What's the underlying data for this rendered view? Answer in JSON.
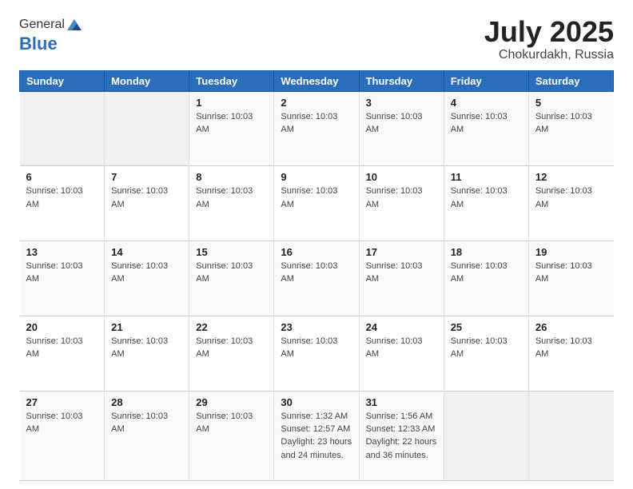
{
  "logo": {
    "general": "General",
    "blue": "Blue"
  },
  "header": {
    "month": "July 2025",
    "location": "Chokurdakh, Russia"
  },
  "columns": [
    "Sunday",
    "Monday",
    "Tuesday",
    "Wednesday",
    "Thursday",
    "Friday",
    "Saturday"
  ],
  "weeks": [
    [
      {
        "day": "",
        "info": ""
      },
      {
        "day": "",
        "info": ""
      },
      {
        "day": "1",
        "info": "Sunrise: 10:03 AM"
      },
      {
        "day": "2",
        "info": "Sunrise: 10:03 AM"
      },
      {
        "day": "3",
        "info": "Sunrise: 10:03 AM"
      },
      {
        "day": "4",
        "info": "Sunrise: 10:03 AM"
      },
      {
        "day": "5",
        "info": "Sunrise: 10:03 AM"
      }
    ],
    [
      {
        "day": "6",
        "info": "Sunrise: 10:03 AM"
      },
      {
        "day": "7",
        "info": "Sunrise: 10:03 AM"
      },
      {
        "day": "8",
        "info": "Sunrise: 10:03 AM"
      },
      {
        "day": "9",
        "info": "Sunrise: 10:03 AM"
      },
      {
        "day": "10",
        "info": "Sunrise: 10:03 AM"
      },
      {
        "day": "11",
        "info": "Sunrise: 10:03 AM"
      },
      {
        "day": "12",
        "info": "Sunrise: 10:03 AM"
      }
    ],
    [
      {
        "day": "13",
        "info": "Sunrise: 10:03 AM"
      },
      {
        "day": "14",
        "info": "Sunrise: 10:03 AM"
      },
      {
        "day": "15",
        "info": "Sunrise: 10:03 AM"
      },
      {
        "day": "16",
        "info": "Sunrise: 10:03 AM"
      },
      {
        "day": "17",
        "info": "Sunrise: 10:03 AM"
      },
      {
        "day": "18",
        "info": "Sunrise: 10:03 AM"
      },
      {
        "day": "19",
        "info": "Sunrise: 10:03 AM"
      }
    ],
    [
      {
        "day": "20",
        "info": "Sunrise: 10:03 AM"
      },
      {
        "day": "21",
        "info": "Sunrise: 10:03 AM"
      },
      {
        "day": "22",
        "info": "Sunrise: 10:03 AM"
      },
      {
        "day": "23",
        "info": "Sunrise: 10:03 AM"
      },
      {
        "day": "24",
        "info": "Sunrise: 10:03 AM"
      },
      {
        "day": "25",
        "info": "Sunrise: 10:03 AM"
      },
      {
        "day": "26",
        "info": "Sunrise: 10:03 AM"
      }
    ],
    [
      {
        "day": "27",
        "info": "Sunrise: 10:03 AM"
      },
      {
        "day": "28",
        "info": "Sunrise: 10:03 AM"
      },
      {
        "day": "29",
        "info": "Sunrise: 10:03 AM"
      },
      {
        "day": "30",
        "info": "Sunrise: 1:32 AM\nSunset: 12:57 AM\nDaylight: 23 hours and 24 minutes."
      },
      {
        "day": "31",
        "info": "Sunrise: 1:56 AM\nSunset: 12:33 AM\nDaylight: 22 hours and 36 minutes."
      },
      {
        "day": "",
        "info": ""
      },
      {
        "day": "",
        "info": ""
      }
    ]
  ]
}
